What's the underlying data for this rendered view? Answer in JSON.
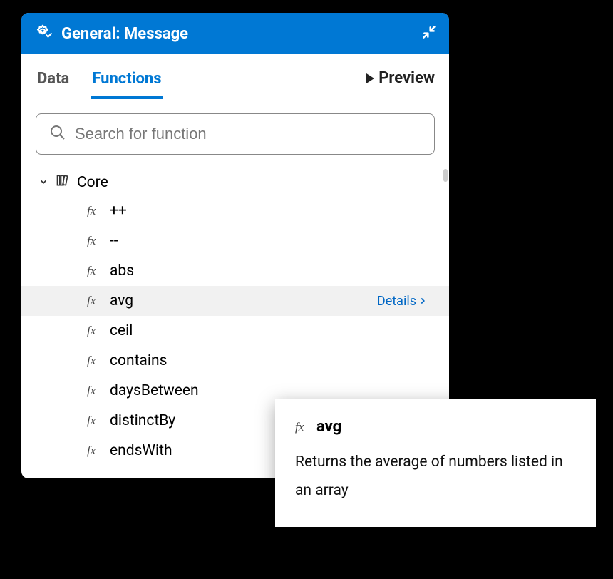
{
  "header": {
    "title": "General: Message"
  },
  "tabs": {
    "data": "Data",
    "functions": "Functions",
    "preview": "Preview"
  },
  "search": {
    "placeholder": "Search for function"
  },
  "group": {
    "name": "Core"
  },
  "functions": [
    {
      "name": "++"
    },
    {
      "name": "--"
    },
    {
      "name": "abs"
    },
    {
      "name": "avg",
      "selected": true
    },
    {
      "name": "ceil"
    },
    {
      "name": "contains"
    },
    {
      "name": "daysBetween"
    },
    {
      "name": "distinctBy"
    },
    {
      "name": "endsWith"
    }
  ],
  "details_label": "Details",
  "tooltip": {
    "name": "avg",
    "description": "Returns the average of numbers listed in an array"
  }
}
